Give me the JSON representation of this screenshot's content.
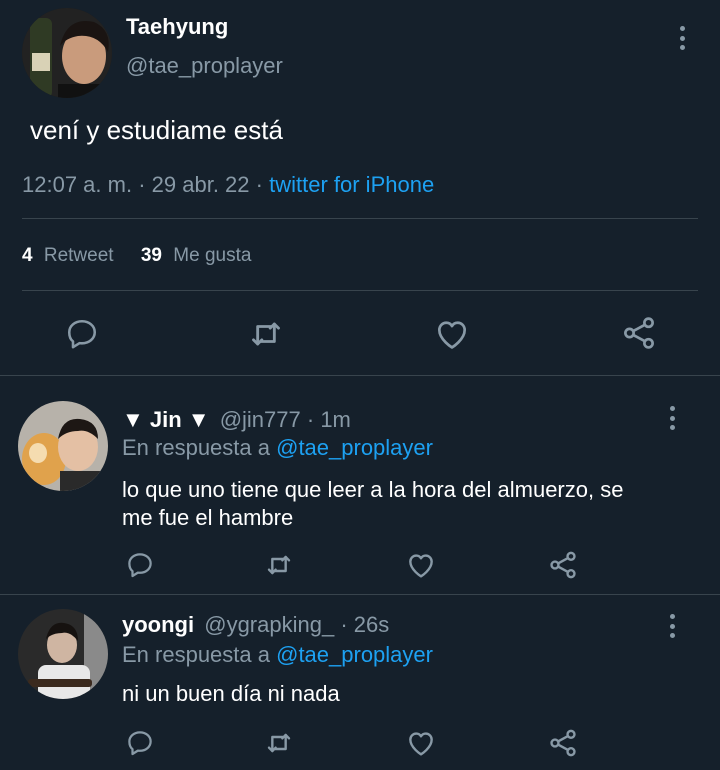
{
  "main_tweet": {
    "author_name": "Taehyung",
    "handle": "@tae_proplayer",
    "text": "vení y estudiame está",
    "time": "12:07 a. m.",
    "sep1": "·",
    "date": "29 abr. 22",
    "sep2": "·",
    "source": "twitter for iPhone",
    "retweets_count": "4",
    "retweets_label": "Retweet",
    "likes_count": "39",
    "likes_label": "Me gusta"
  },
  "replies": [
    {
      "author_name": "▼ Jin ▼",
      "handle": "@jin777",
      "time": "· 1m",
      "reply_prefix": "En respuesta a",
      "reply_to": "@tae_proplayer",
      "text_line1": "lo que uno tiene que leer a la hora del almuerzo, se",
      "text_line2": "me fue el hambre"
    },
    {
      "author_name": "yoongi",
      "handle": "@ygrapking_",
      "time": "· 26s",
      "reply_prefix": "En respuesta a",
      "reply_to": "@tae_proplayer",
      "text_line1": "ni un buen día ni nada"
    }
  ],
  "colors": {
    "background": "#15202b",
    "text": "#ffffff",
    "muted": "#8899a6",
    "accent": "#1da1f2",
    "divider": "#38444d"
  },
  "icons": {
    "reply": "speech-bubble-icon",
    "retweet": "retweet-arrows-icon",
    "like": "heart-icon",
    "share": "share-nodes-icon",
    "more": "vertical-dots-icon"
  }
}
